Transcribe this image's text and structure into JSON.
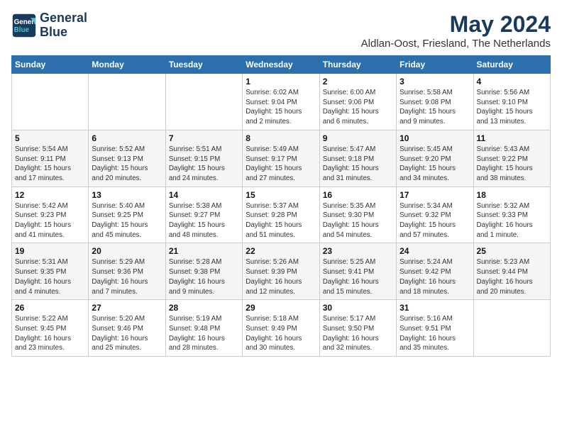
{
  "logo": {
    "line1": "General",
    "line2": "Blue"
  },
  "title": "May 2024",
  "subtitle": "Aldlan-Oost, Friesland, The Netherlands",
  "days_of_week": [
    "Sunday",
    "Monday",
    "Tuesday",
    "Wednesday",
    "Thursday",
    "Friday",
    "Saturday"
  ],
  "weeks": [
    [
      {
        "day": "",
        "info": ""
      },
      {
        "day": "",
        "info": ""
      },
      {
        "day": "",
        "info": ""
      },
      {
        "day": "1",
        "info": "Sunrise: 6:02 AM\nSunset: 9:04 PM\nDaylight: 15 hours\nand 2 minutes."
      },
      {
        "day": "2",
        "info": "Sunrise: 6:00 AM\nSunset: 9:06 PM\nDaylight: 15 hours\nand 6 minutes."
      },
      {
        "day": "3",
        "info": "Sunrise: 5:58 AM\nSunset: 9:08 PM\nDaylight: 15 hours\nand 9 minutes."
      },
      {
        "day": "4",
        "info": "Sunrise: 5:56 AM\nSunset: 9:10 PM\nDaylight: 15 hours\nand 13 minutes."
      }
    ],
    [
      {
        "day": "5",
        "info": "Sunrise: 5:54 AM\nSunset: 9:11 PM\nDaylight: 15 hours\nand 17 minutes."
      },
      {
        "day": "6",
        "info": "Sunrise: 5:52 AM\nSunset: 9:13 PM\nDaylight: 15 hours\nand 20 minutes."
      },
      {
        "day": "7",
        "info": "Sunrise: 5:51 AM\nSunset: 9:15 PM\nDaylight: 15 hours\nand 24 minutes."
      },
      {
        "day": "8",
        "info": "Sunrise: 5:49 AM\nSunset: 9:17 PM\nDaylight: 15 hours\nand 27 minutes."
      },
      {
        "day": "9",
        "info": "Sunrise: 5:47 AM\nSunset: 9:18 PM\nDaylight: 15 hours\nand 31 minutes."
      },
      {
        "day": "10",
        "info": "Sunrise: 5:45 AM\nSunset: 9:20 PM\nDaylight: 15 hours\nand 34 minutes."
      },
      {
        "day": "11",
        "info": "Sunrise: 5:43 AM\nSunset: 9:22 PM\nDaylight: 15 hours\nand 38 minutes."
      }
    ],
    [
      {
        "day": "12",
        "info": "Sunrise: 5:42 AM\nSunset: 9:23 PM\nDaylight: 15 hours\nand 41 minutes."
      },
      {
        "day": "13",
        "info": "Sunrise: 5:40 AM\nSunset: 9:25 PM\nDaylight: 15 hours\nand 45 minutes."
      },
      {
        "day": "14",
        "info": "Sunrise: 5:38 AM\nSunset: 9:27 PM\nDaylight: 15 hours\nand 48 minutes."
      },
      {
        "day": "15",
        "info": "Sunrise: 5:37 AM\nSunset: 9:28 PM\nDaylight: 15 hours\nand 51 minutes."
      },
      {
        "day": "16",
        "info": "Sunrise: 5:35 AM\nSunset: 9:30 PM\nDaylight: 15 hours\nand 54 minutes."
      },
      {
        "day": "17",
        "info": "Sunrise: 5:34 AM\nSunset: 9:32 PM\nDaylight: 15 hours\nand 57 minutes."
      },
      {
        "day": "18",
        "info": "Sunrise: 5:32 AM\nSunset: 9:33 PM\nDaylight: 16 hours\nand 1 minute."
      }
    ],
    [
      {
        "day": "19",
        "info": "Sunrise: 5:31 AM\nSunset: 9:35 PM\nDaylight: 16 hours\nand 4 minutes."
      },
      {
        "day": "20",
        "info": "Sunrise: 5:29 AM\nSunset: 9:36 PM\nDaylight: 16 hours\nand 7 minutes."
      },
      {
        "day": "21",
        "info": "Sunrise: 5:28 AM\nSunset: 9:38 PM\nDaylight: 16 hours\nand 9 minutes."
      },
      {
        "day": "22",
        "info": "Sunrise: 5:26 AM\nSunset: 9:39 PM\nDaylight: 16 hours\nand 12 minutes."
      },
      {
        "day": "23",
        "info": "Sunrise: 5:25 AM\nSunset: 9:41 PM\nDaylight: 16 hours\nand 15 minutes."
      },
      {
        "day": "24",
        "info": "Sunrise: 5:24 AM\nSunset: 9:42 PM\nDaylight: 16 hours\nand 18 minutes."
      },
      {
        "day": "25",
        "info": "Sunrise: 5:23 AM\nSunset: 9:44 PM\nDaylight: 16 hours\nand 20 minutes."
      }
    ],
    [
      {
        "day": "26",
        "info": "Sunrise: 5:22 AM\nSunset: 9:45 PM\nDaylight: 16 hours\nand 23 minutes."
      },
      {
        "day": "27",
        "info": "Sunrise: 5:20 AM\nSunset: 9:46 PM\nDaylight: 16 hours\nand 25 minutes."
      },
      {
        "day": "28",
        "info": "Sunrise: 5:19 AM\nSunset: 9:48 PM\nDaylight: 16 hours\nand 28 minutes."
      },
      {
        "day": "29",
        "info": "Sunrise: 5:18 AM\nSunset: 9:49 PM\nDaylight: 16 hours\nand 30 minutes."
      },
      {
        "day": "30",
        "info": "Sunrise: 5:17 AM\nSunset: 9:50 PM\nDaylight: 16 hours\nand 32 minutes."
      },
      {
        "day": "31",
        "info": "Sunrise: 5:16 AM\nSunset: 9:51 PM\nDaylight: 16 hours\nand 35 minutes."
      },
      {
        "day": "",
        "info": ""
      }
    ]
  ]
}
